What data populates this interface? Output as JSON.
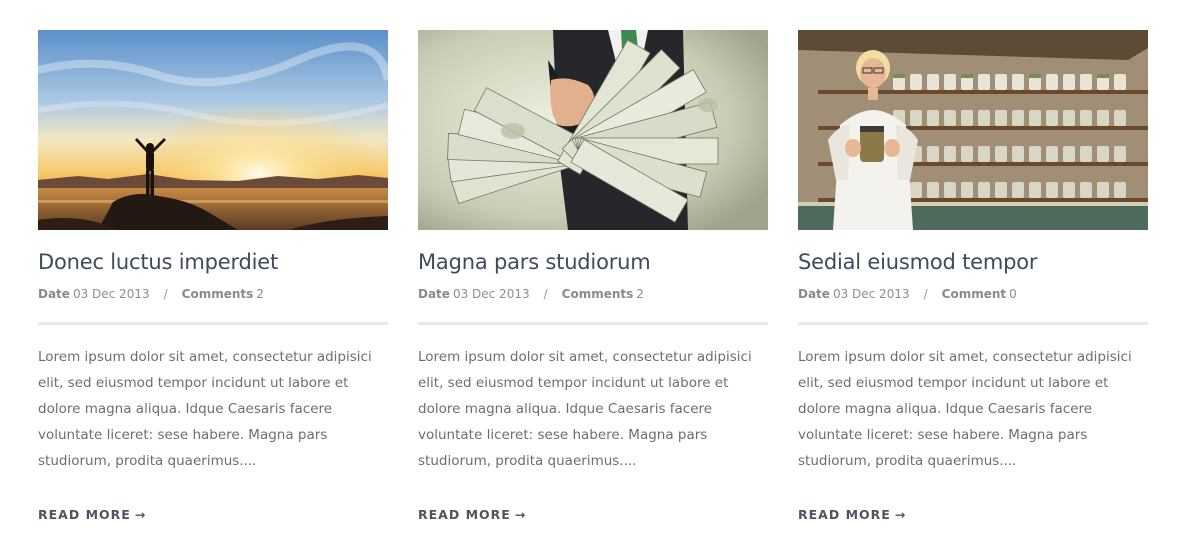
{
  "posts": [
    {
      "image_alt": "Silhouette of a person with raised arms at sunset over the sea",
      "title": "Donec luctus imperdiet",
      "date_label": "Date",
      "date": "03 Dec 2013",
      "separator": "/",
      "comments_label": "Comments",
      "comments_count": "2",
      "excerpt": "Lorem ipsum dolor sit amet, consectetur adipisici elit, sed eiusmod tempor incidunt ut labore et dolore magna aliqua. Idque Caesaris facere voluntate liceret: sese habere. Magna pars studiorum, prodita quaerimus....",
      "read_more": "READ MORE",
      "arrow": "→"
    },
    {
      "image_alt": "Businessman holding out a fan of dollar bills",
      "title": "Magna pars studiorum",
      "date_label": "Date",
      "date": "03 Dec 2013",
      "separator": "/",
      "comments_label": "Comments",
      "comments_count": "2",
      "excerpt": "Lorem ipsum dolor sit amet, consectetur adipisici elit, sed eiusmod tempor incidunt ut labore et dolore magna aliqua. Idque Caesaris facere voluntate liceret: sese habere. Magna pars studiorum, prodita quaerimus....",
      "read_more": "READ MORE",
      "arrow": "→"
    },
    {
      "image_alt": "Smiling shopkeeper in apron holding a jar in front of shelves of jars",
      "title": "Sedial eiusmod tempor",
      "date_label": "Date",
      "date": "03 Dec 2013",
      "separator": "/",
      "comments_label": "Comment",
      "comments_count": "0",
      "excerpt": "Lorem ipsum dolor sit amet, consectetur adipisici elit, sed eiusmod tempor incidunt ut labore et dolore magna aliqua. Idque Caesaris facere voluntate liceret: sese habere. Magna pars studiorum, prodita quaerimus....",
      "read_more": "READ MORE",
      "arrow": "→"
    }
  ],
  "colors": {
    "title": "#3f4b5c",
    "meta": "#8d8d8d",
    "divider": "#e8e9ec",
    "excerpt": "#6b6e73",
    "read_more": "#4e5560"
  }
}
